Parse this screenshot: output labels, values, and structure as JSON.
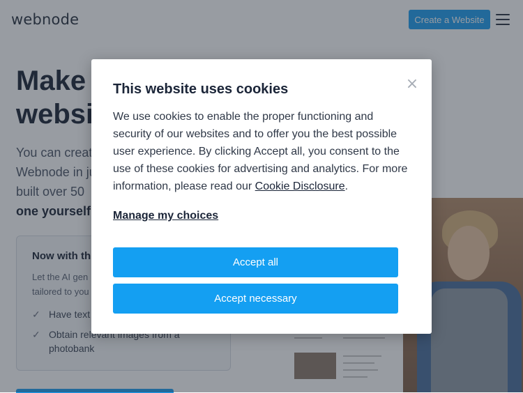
{
  "header": {
    "logo": "webnode",
    "cta_label": "Create a Website"
  },
  "hero": {
    "title_line1": "Make",
    "title_line2": "websi",
    "text_line1": "You can creat",
    "text_line2": "Webnode in ju",
    "text_line3": "built over 50",
    "text_line4_bold": "one yourself."
  },
  "card": {
    "title": "Now with th",
    "sub_line1": "Let the AI gen",
    "sub_line2": "tailored to you",
    "item1": "Have text",
    "item2_line1": "Obtain relevant images from a",
    "item2_line2": "photobank"
  },
  "modal": {
    "title": "This website uses cookies",
    "body_text": "We use cookies to enable the proper functioning and security of our websites and to offer you the best possible user experience. By clicking Accept all, you consent to the use of these cookies for advertising and analytics. For more information, please read our ",
    "link_text": "Cookie Disclosure",
    "body_end": ".",
    "manage_label": "Manage my choices",
    "accept_all_label": "Accept all",
    "accept_necessary_label": "Accept necessary",
    "close_symbol": "×"
  },
  "colors": {
    "accent": "#149ff2",
    "overlay": "rgba(40,48,60,0.48)"
  }
}
